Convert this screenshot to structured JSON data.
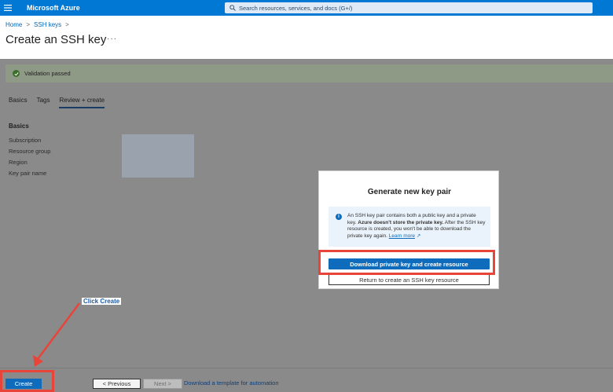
{
  "header": {
    "brand": "Microsoft Azure",
    "search_placeholder": "Search resources, services, and docs (G+/)",
    "color": "#0078d4"
  },
  "breadcrumb": {
    "items": [
      "Home",
      "SSH keys"
    ]
  },
  "page": {
    "title": "Create an SSH key",
    "more": "···"
  },
  "validation": {
    "text": "Validation passed"
  },
  "tabs": [
    "Basics",
    "Tags",
    "Review + create"
  ],
  "basics": {
    "heading": "Basics",
    "fields": [
      "Subscription",
      "Resource group",
      "Region",
      "Key pair name"
    ]
  },
  "dialog": {
    "title": "Generate new key pair",
    "info_part1": "An SSH key pair contains both a public key and a private key.",
    "info_bold": "Azure doesn't store the private key.",
    "info_part2": "After the SSH key resource is created, you won't be able to download the private key again.",
    "learn_more": "Learn more",
    "primary_button": "Download private key and create resource",
    "secondary_button": "Return to create an SSH key resource"
  },
  "footer": {
    "create": "Create",
    "previous": "< Previous",
    "next": "Next >",
    "template_link": "Download a template for automation"
  },
  "annotation": {
    "callout": "Click Create",
    "color": "#e8443a"
  }
}
